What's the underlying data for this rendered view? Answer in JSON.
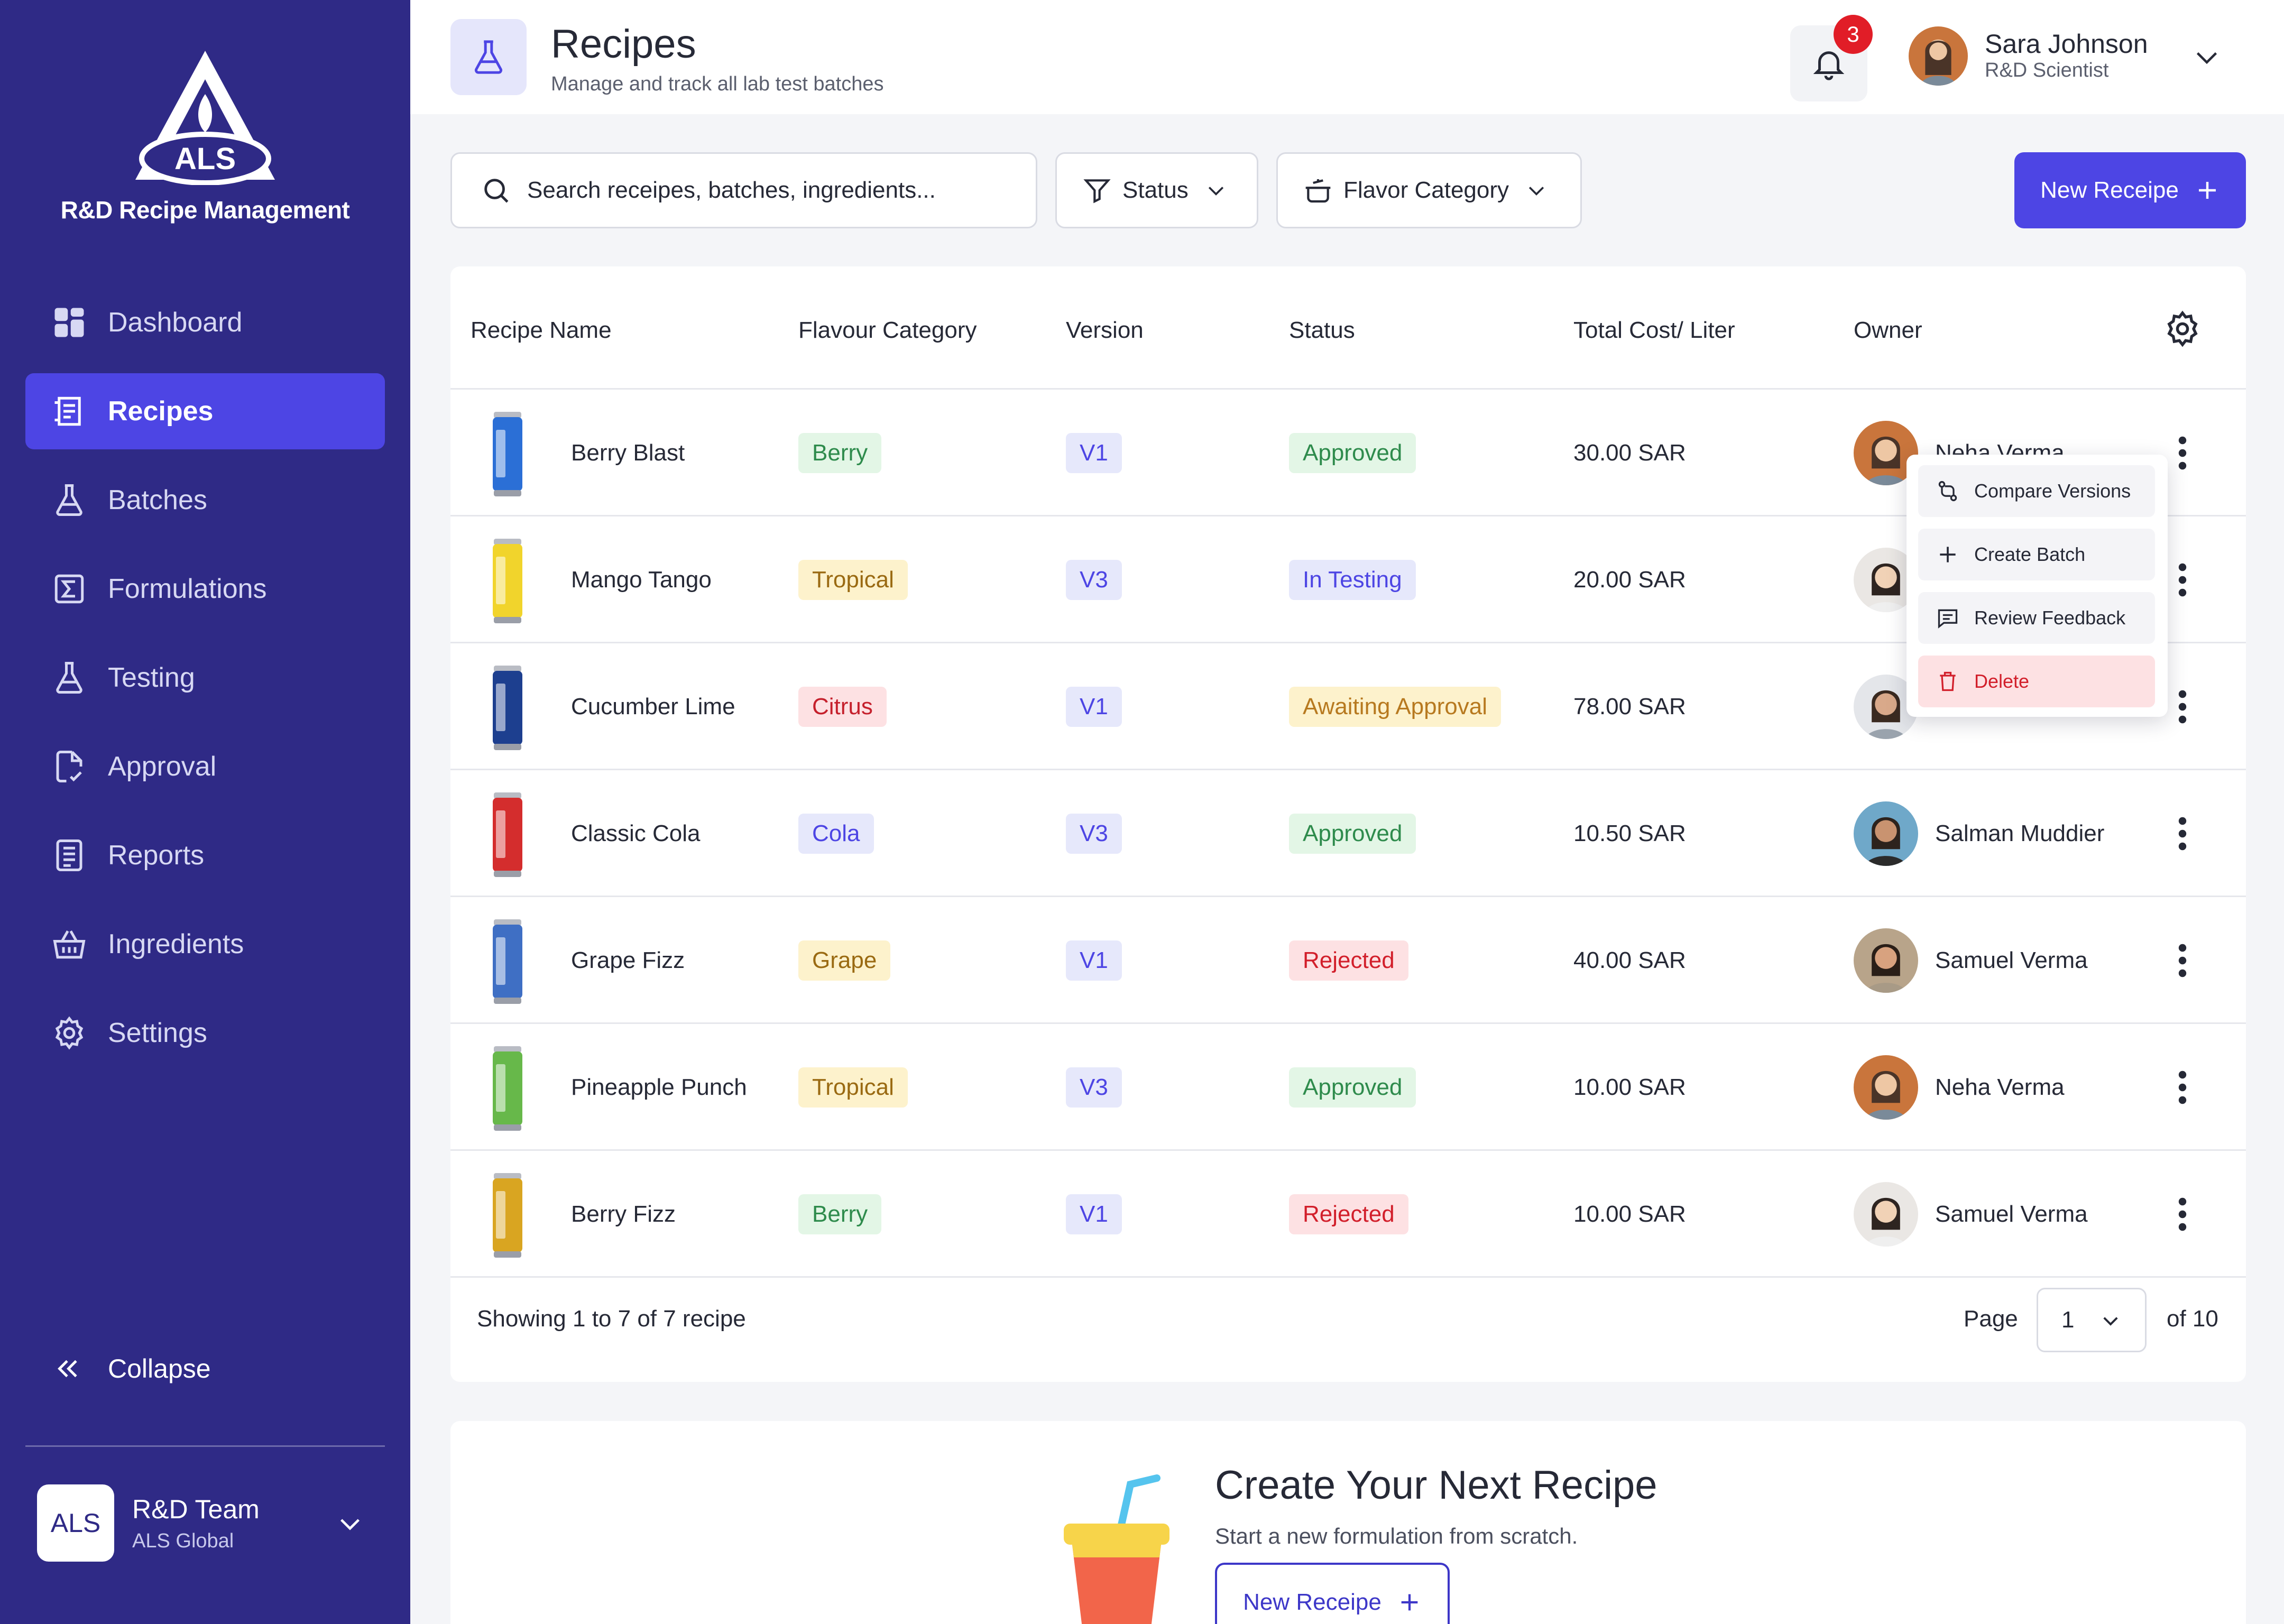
{
  "sidebar": {
    "logo_text": "ALS",
    "brand": "R&D Recipe Management",
    "items": [
      {
        "label": "Dashboard",
        "icon": "dashboard-icon"
      },
      {
        "label": "Recipes",
        "icon": "recipes-icon"
      },
      {
        "label": "Batches",
        "icon": "flask-icon"
      },
      {
        "label": "Formulations",
        "icon": "sigma-icon"
      },
      {
        "label": "Testing",
        "icon": "flask-icon"
      },
      {
        "label": "Approval",
        "icon": "approval-doc-icon"
      },
      {
        "label": "Reports",
        "icon": "report-icon"
      },
      {
        "label": "Ingredients",
        "icon": "basket-icon"
      },
      {
        "label": "Settings",
        "icon": "gear-icon"
      }
    ],
    "active_item": "Recipes",
    "collapse_label": "Collapse",
    "team": {
      "badge": "ALS",
      "name": "R&D Team",
      "org": "ALS Global"
    }
  },
  "header": {
    "title": "Recipes",
    "subtitle": "Manage and track all lab test batches",
    "notification_count": "3",
    "user": {
      "name": "Sara Johnson",
      "role": "R&D Scientist"
    }
  },
  "toolbar": {
    "search_placeholder": "Search receipes, batches, ingredients...",
    "status_filter": "Status",
    "category_filter": "Flavor Category",
    "new_button": "New Receipe"
  },
  "table": {
    "columns": [
      "Recipe Name",
      "Flavour Category",
      "Version",
      "Status",
      "Total Cost/ Liter",
      "Owner"
    ],
    "rows": [
      {
        "name": "Berry Blast",
        "category": "Berry",
        "version": "V1",
        "status": "Approved",
        "cost": "30.00 SAR",
        "owner": "Neha Verma",
        "can_color": "#2b6fd6"
      },
      {
        "name": "Mango Tango",
        "category": "Tropical",
        "version": "V3",
        "status": "In Testing",
        "cost": "20.00 SAR",
        "owner": "",
        "can_color": "#f1d42c"
      },
      {
        "name": "Cucumber Lime",
        "category": "Citrus",
        "version": "V1",
        "status": "Awaiting Approval",
        "cost": "78.00 SAR",
        "owner": "",
        "can_color": "#1d3f8f"
      },
      {
        "name": "Classic Cola",
        "category": "Cola",
        "version": "V3",
        "status": "Approved",
        "cost": "10.50 SAR",
        "owner": "Salman Muddier",
        "can_color": "#d42d2d"
      },
      {
        "name": "Grape Fizz",
        "category": "Grape",
        "version": "V1",
        "status": "Rejected",
        "cost": "40.00 SAR",
        "owner": "Samuel Verma",
        "can_color": "#3f6fc4"
      },
      {
        "name": "Pineapple Punch",
        "category": "Tropical",
        "version": "V3",
        "status": "Approved",
        "cost": "10.00 SAR",
        "owner": "Neha Verma",
        "can_color": "#67b84a"
      },
      {
        "name": "Berry Fizz",
        "category": "Berry",
        "version": "V1",
        "status": "Rejected",
        "cost": "10.00 SAR",
        "owner": "Samuel Verma",
        "can_color": "#d9a521"
      }
    ],
    "footer": {
      "showing": "Showing 1 to 7  of 7 recipe",
      "page_label": "Page",
      "page_value": "1",
      "page_total": "of 10"
    }
  },
  "context_menu": {
    "items": [
      "Compare Versions",
      "Create Batch",
      "Review Feedback",
      "Delete"
    ]
  },
  "cta": {
    "title": "Create Your Next Recipe",
    "subtitle": "Start a new formulation from scratch.",
    "button": "New Receipe"
  },
  "colors": {
    "sidebar_bg": "#2f2a86",
    "accent": "#4d45e4",
    "approved": "#2e8b4c",
    "testing": "#4d45e4",
    "awaiting": "#b7791f",
    "rejected": "#d21f2b"
  }
}
